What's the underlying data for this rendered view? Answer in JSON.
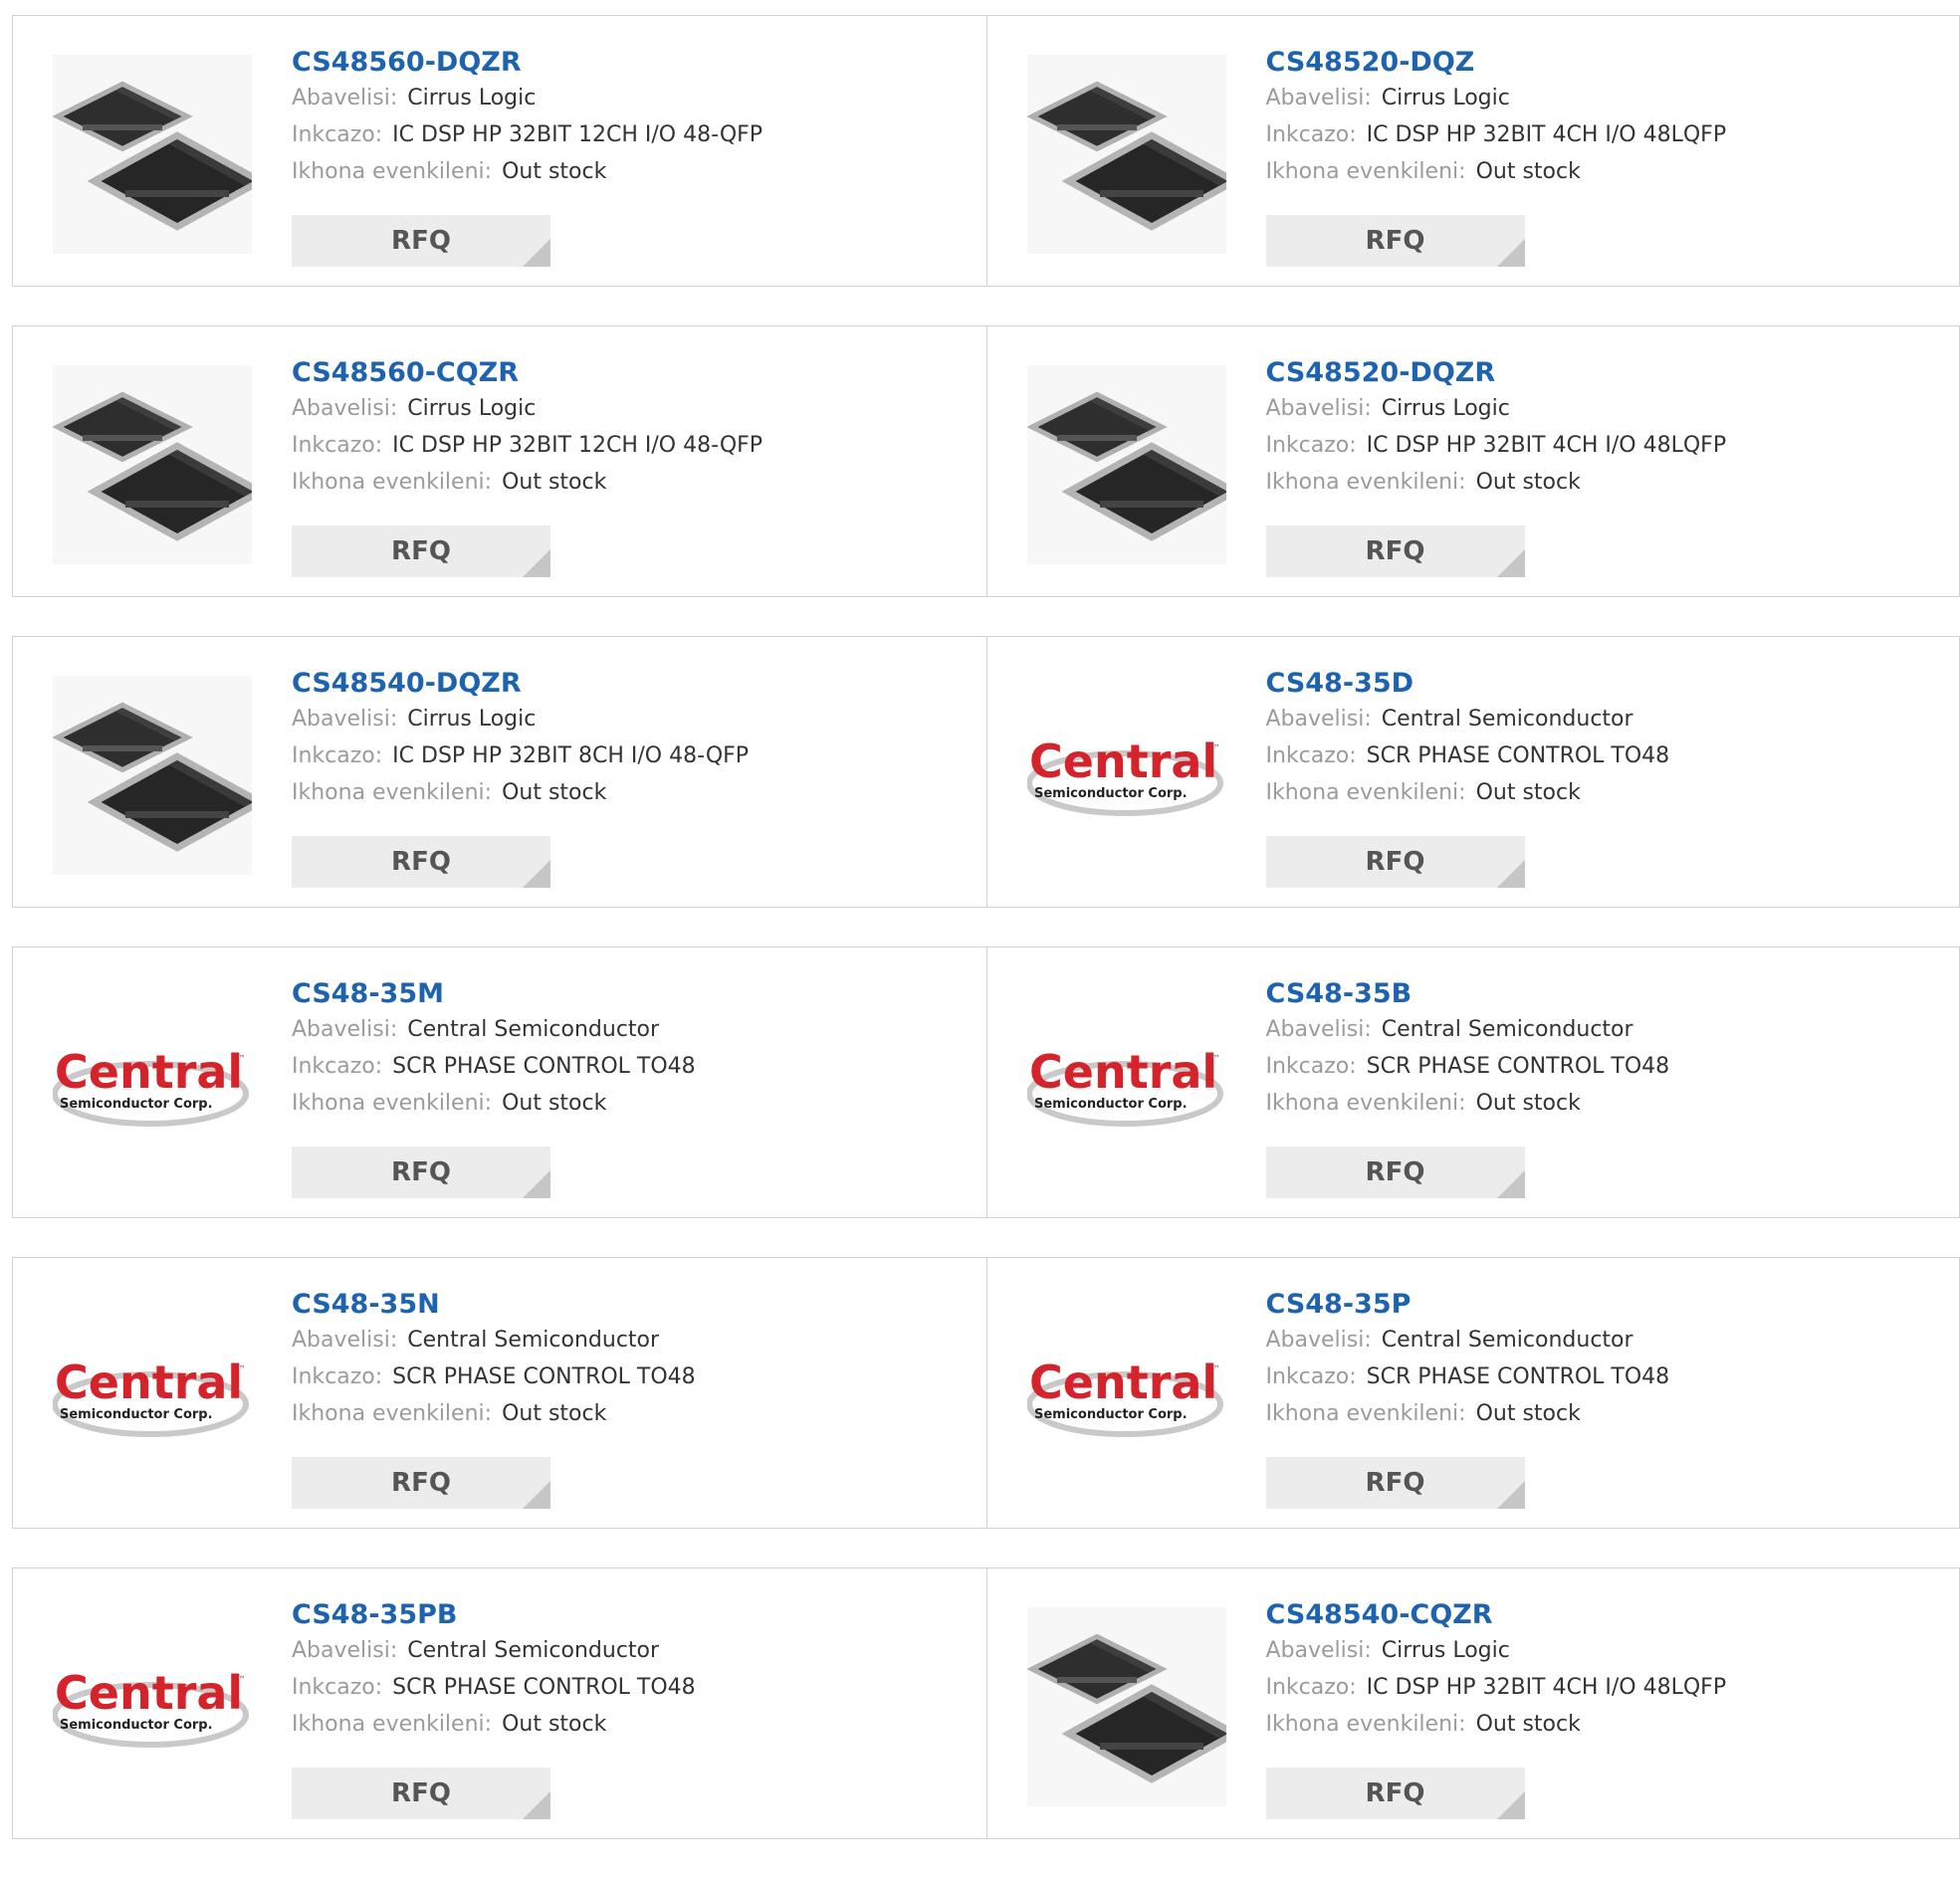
{
  "labels": {
    "manufacturer": "Abavelisi:",
    "description": "Inkcazo:",
    "stock": "Ikhona evenkileni:",
    "rfq": "RFQ"
  },
  "colors": {
    "part_link": "#1e63b0",
    "rfq_bg": "#ececec",
    "border": "#d2d2d2"
  },
  "products": [
    {
      "part": "CS48560-DQZR",
      "manufacturer": "Cirrus Logic",
      "description": "IC DSP HP 32BIT 12CH I/O 48-QFP",
      "stock": "Out stock",
      "image": "qfp-chip"
    },
    {
      "part": "CS48520-DQZ",
      "manufacturer": "Cirrus Logic",
      "description": "IC DSP HP 32BIT 4CH I/O 48LQFP",
      "stock": "Out stock",
      "image": "qfp-chip"
    },
    {
      "part": "CS48560-CQZR",
      "manufacturer": "Cirrus Logic",
      "description": "IC DSP HP 32BIT 12CH I/O 48-QFP",
      "stock": "Out stock",
      "image": "qfp-chip"
    },
    {
      "part": "CS48520-DQZR",
      "manufacturer": "Cirrus Logic",
      "description": "IC DSP HP 32BIT 4CH I/O 48LQFP",
      "stock": "Out stock",
      "image": "qfp-chip"
    },
    {
      "part": "CS48540-DQZR",
      "manufacturer": "Cirrus Logic",
      "description": "IC DSP HP 32BIT 8CH I/O 48-QFP",
      "stock": "Out stock",
      "image": "qfp-chip"
    },
    {
      "part": "CS48-35D",
      "manufacturer": "Central Semiconductor",
      "description": "SCR PHASE CONTROL TO48",
      "stock": "Out stock",
      "image": "central-logo"
    },
    {
      "part": "CS48-35M",
      "manufacturer": "Central Semiconductor",
      "description": "SCR PHASE CONTROL TO48",
      "stock": "Out stock",
      "image": "central-logo"
    },
    {
      "part": "CS48-35B",
      "manufacturer": "Central Semiconductor",
      "description": "SCR PHASE CONTROL TO48",
      "stock": "Out stock",
      "image": "central-logo"
    },
    {
      "part": "CS48-35N",
      "manufacturer": "Central Semiconductor",
      "description": "SCR PHASE CONTROL TO48",
      "stock": "Out stock",
      "image": "central-logo"
    },
    {
      "part": "CS48-35P",
      "manufacturer": "Central Semiconductor",
      "description": "SCR PHASE CONTROL TO48",
      "stock": "Out stock",
      "image": "central-logo"
    },
    {
      "part": "CS48-35PB",
      "manufacturer": "Central Semiconductor",
      "description": "SCR PHASE CONTROL TO48",
      "stock": "Out stock",
      "image": "central-logo"
    },
    {
      "part": "CS48540-CQZR",
      "manufacturer": "Cirrus Logic",
      "description": "IC DSP HP 32BIT 4CH I/O 48LQFP",
      "stock": "Out stock",
      "image": "qfp-chip"
    }
  ],
  "logo_text": {
    "brand": "Central",
    "tm": "™",
    "sub": "Semiconductor Corp."
  }
}
